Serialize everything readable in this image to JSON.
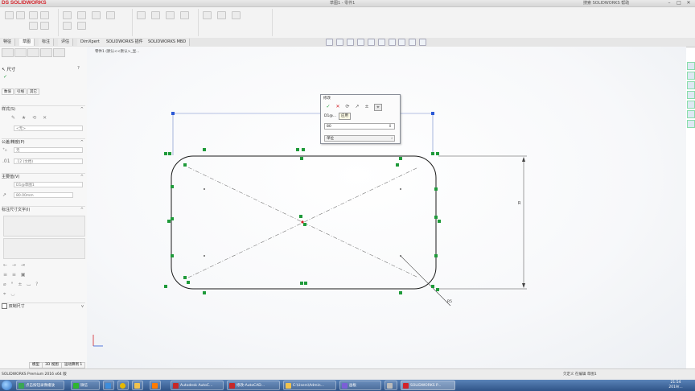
{
  "app": {
    "logo": "DS SOLIDWORKS",
    "document_title": "草图1 - 零件1",
    "search_hint": "搜索 SOLIDWORKS 帮助"
  },
  "tabs": [
    "特征",
    "草图",
    "标注",
    "评估",
    "DimXpert",
    "SOLIDWORKS 插件",
    "SOLIDWORKS MBD"
  ],
  "active_tab": "草图",
  "breadcrumb": "零件1 (默认<<默认>_显...",
  "left_panel": {
    "title": "尺寸",
    "subtabs": [
      "数值",
      "引线",
      "其它"
    ],
    "sections": {
      "style": "样式(S)",
      "tolerance": "公差/精度(P)",
      "primary": "主要值(V)",
      "dual": "标注尺寸文字(I)",
      "dual_dim": "双制尺寸"
    },
    "style_dropdown": "<无>",
    "tolerance_type": "无",
    "precision": ".12 (文档)",
    "primary_name": "D1@草图1",
    "primary_value": "80.00mm"
  },
  "dialog": {
    "title": "修改",
    "name_value": "D1@...",
    "tooltip": "应用",
    "input_value": "80",
    "units_label": "单位"
  },
  "status_bar": {
    "left_text": "SOLIDWORKS Premium 2016 x64 版",
    "bottom_tabs": [
      "模型",
      "3D 视图",
      "运动算例 1"
    ],
    "right_text": "欠定义   在编辑 草图1"
  },
  "taskbar": {
    "items": [
      "点击按钮录像播放",
      "微信",
      "Autodesk AutoC...",
      "修改-AutoCAD...",
      "C:\\Users\\Admin...",
      "画板",
      "SOLIDWORKS P..."
    ],
    "clock_time": "21:54",
    "clock_date": "2019/..."
  },
  "sketch": {
    "dimension_labels": {
      "right": "R",
      "diag": "R5"
    }
  },
  "colors": {
    "accent_red": "#d2232a",
    "sketch_line": "#1b1b1b",
    "relation_green": "#1f9a3a",
    "selected_blue": "#2b59d6"
  }
}
